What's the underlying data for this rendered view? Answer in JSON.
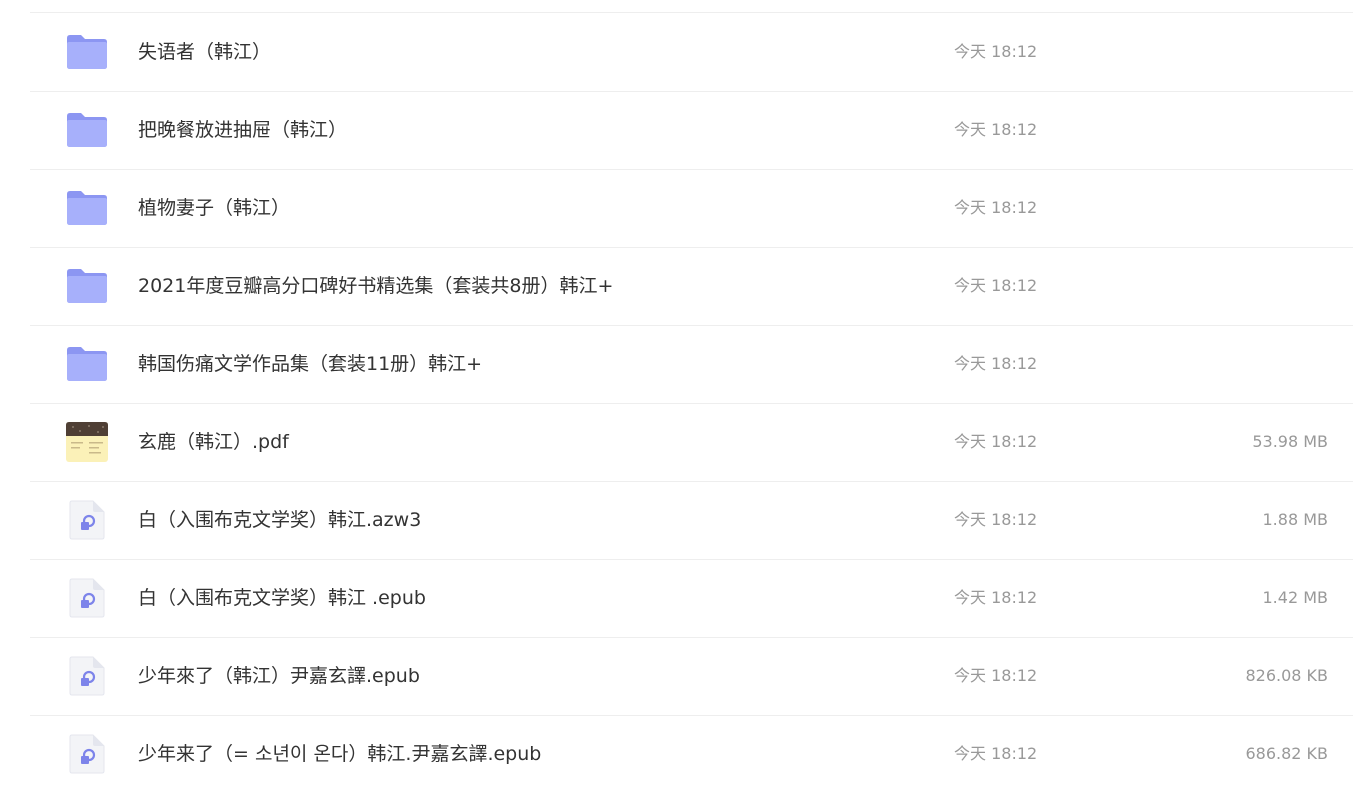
{
  "colors": {
    "folder_back": "#8c96f2",
    "folder_front": "#a7b0fb",
    "doc_bg": "#f3f4f7",
    "doc_accent": "#7d84ea",
    "pdf_top": "#4f3f35",
    "pdf_bg": "#fbf1b8",
    "divider": "#eeeeee",
    "text_primary": "#333333",
    "text_secondary": "#999999"
  },
  "files": [
    {
      "type": "folder",
      "icon": "folder-icon",
      "name": "失语者（韩江）",
      "time": "今天 18:12",
      "size": ""
    },
    {
      "type": "folder",
      "icon": "folder-icon",
      "name": "把晚餐放进抽屉（韩江）",
      "time": "今天 18:12",
      "size": ""
    },
    {
      "type": "folder",
      "icon": "folder-icon",
      "name": "植物妻子（韩江）",
      "time": "今天 18:12",
      "size": ""
    },
    {
      "type": "folder",
      "icon": "folder-icon",
      "name": "2021年度豆瓣高分口碑好书精选集（套装共8册）韩江+",
      "time": "今天 18:12",
      "size": ""
    },
    {
      "type": "folder",
      "icon": "folder-icon",
      "name": "韩国伤痛文学作品集（套装11册）韩江+",
      "time": "今天 18:12",
      "size": ""
    },
    {
      "type": "pdf",
      "icon": "pdf-thumbnail-icon",
      "name": "玄鹿（韩江）.pdf",
      "time": "今天 18:12",
      "size": "53.98 MB"
    },
    {
      "type": "ebook",
      "icon": "ebook-file-icon",
      "name": "白（入围布克文学奖）韩江.azw3",
      "time": "今天 18:12",
      "size": "1.88 MB"
    },
    {
      "type": "ebook",
      "icon": "ebook-file-icon",
      "name": "白（入围布克文学奖）韩江 .epub",
      "time": "今天 18:12",
      "size": "1.42 MB"
    },
    {
      "type": "ebook",
      "icon": "ebook-file-icon",
      "name": "少年來了（韩江）尹嘉玄譯.epub",
      "time": "今天 18:12",
      "size": "826.08 KB"
    },
    {
      "type": "ebook",
      "icon": "ebook-file-icon",
      "name": "少年来了（= 소년이 온다）韩江.尹嘉玄譯.epub",
      "time": "今天 18:12",
      "size": "686.82 KB"
    }
  ]
}
